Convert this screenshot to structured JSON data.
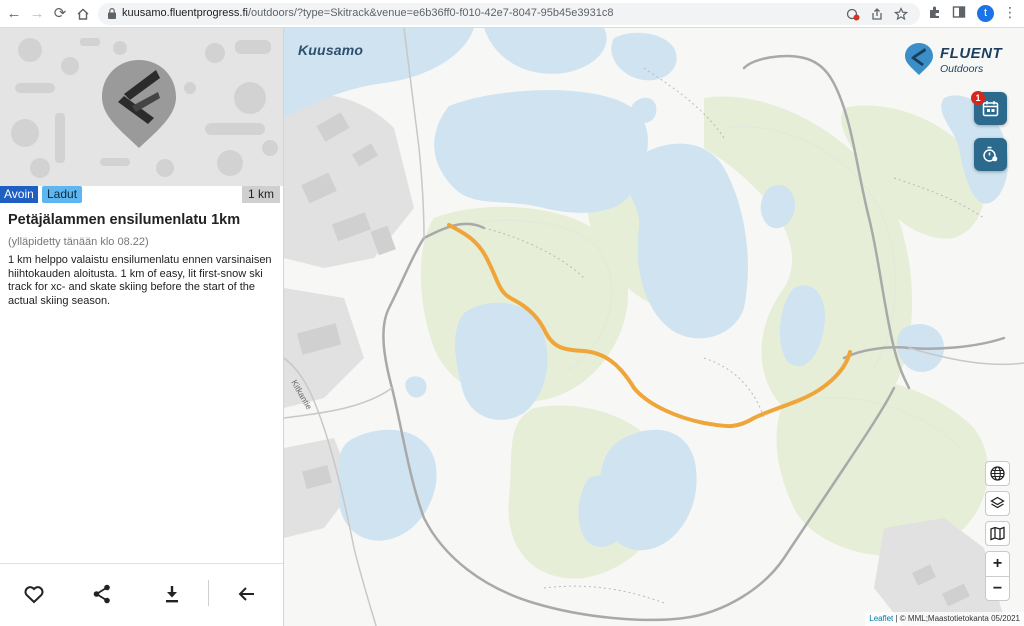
{
  "browser": {
    "url_host": "kuusamo.fluentprogress.fi",
    "url_path": "/outdoors/?type=Skitrack&venue=e6b36ff0-f010-42e7-8047-95b45e3931c8",
    "profile_initial": "t"
  },
  "track": {
    "status_badge": "Avoin",
    "category_badge": "Ladut",
    "length_badge": "1 km",
    "title": "Petäjälammen ensilumenlatu 1km",
    "maintenance_note": "(ylläpidetty tänään klo 08.22)",
    "description": "1 km helppo valaistu ensilumenlatu ennen varsinaisen hiihtokauden aloitusta. 1 km of easy, lit first-snow ski track for xc- and skate skiing before the start of the actual skiing season."
  },
  "map": {
    "place_label": "Kuusamo",
    "road_label": "Kitkantie",
    "brand_name": "FLUENT",
    "brand_sub": "Outdoors",
    "notification_count": "1",
    "zoom_in": "+",
    "zoom_out": "−",
    "attribution_link": "Leaflet",
    "attribution_text": " | © MML;Maastotietokanta 05/2021",
    "route_color": "#f0a53a"
  },
  "colors": {
    "water": "#cfe3f1",
    "forest": "#e6eed8",
    "brand": "#2b6a8d",
    "status_open": "#1f5fc2",
    "category": "#5db6ef"
  }
}
